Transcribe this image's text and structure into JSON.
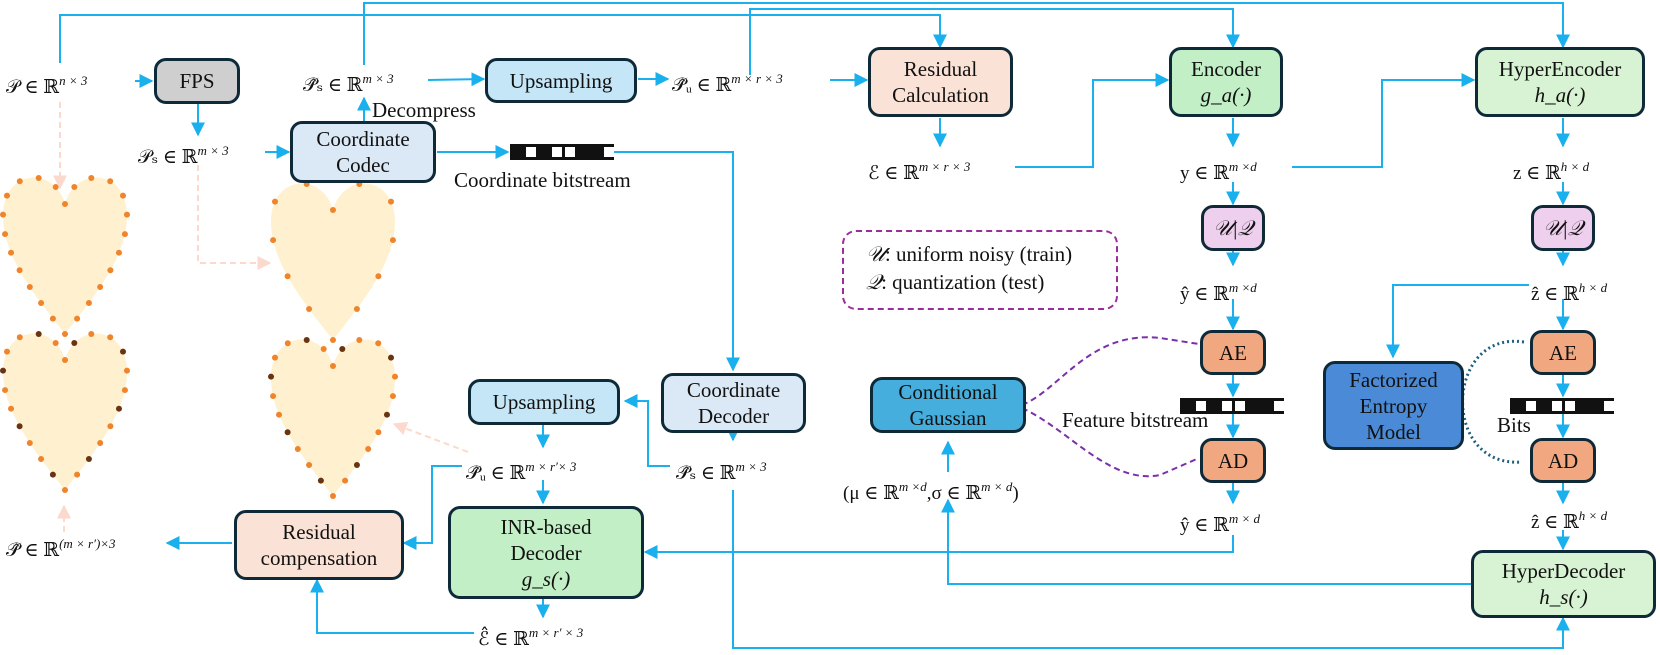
{
  "colors": {
    "arrow": "#1ab0ee",
    "node_border": "#0e2a38",
    "fps": "#cfcfcf",
    "light_blue": "#c5e6f7",
    "pale_blue": "#dbe8f6",
    "peach": "#fbe2d6",
    "green": "#c2efc6",
    "light_green": "#d8f3d3",
    "pink": "#efcfee",
    "orange": "#f1a881",
    "cond_gaussian": "#45aedd",
    "factorized": "#4a8ad6",
    "heart_fill": "#fff1cf",
    "point_orange": "#f0842a",
    "point_dark": "#6b3410",
    "legend_dash": "#9b2c9b",
    "entropy_link": "#1f5f80"
  },
  "nodes": {
    "fps": "FPS",
    "coordinate_codec": [
      "Coordinate",
      "Codec"
    ],
    "upsampling_top": "Upsampling",
    "residual_calculation": [
      "Residual",
      "Calculation"
    ],
    "encoder": [
      "Encoder",
      "g_a(·)"
    ],
    "hyper_encoder": [
      "HyperEncoder",
      "h_a(·)"
    ],
    "uq_main": "𝒰|𝒬",
    "uq_hyper": "𝒰|𝒬",
    "ae_main": "AE",
    "ad_main": "AD",
    "ae_hyper": "AE",
    "ad_hyper": "AD",
    "conditional_gaussian": [
      "Conditional",
      "Gaussian"
    ],
    "factorized_entropy_model": [
      "Factorized",
      "Entropy",
      "Model"
    ],
    "hyper_decoder": [
      "HyperDecoder",
      "h_s(·)"
    ],
    "coordinate_decoder": [
      "Coordinate",
      "Decoder"
    ],
    "upsampling_bottom": "Upsampling",
    "inr_decoder": [
      "INR-based",
      "Decoder",
      "g_s(·)"
    ],
    "residual_compensation": [
      "Residual",
      "compensation"
    ]
  },
  "labels": {
    "p_input": "𝒫 ∈ ℝ^{n × 3}",
    "p_s": "𝒫_s ∈ ℝ^{m × 3}",
    "p_s_hat_top": "𝒫̂_s ∈ ℝ^{m × 3}",
    "p_u_hat_top": "𝒫̂_u ∈ ℝ^{m × r × 3}",
    "e": "ℰ ∈ ℝ^{m × r × 3}",
    "y": "y ∈ ℝ^{m × d}",
    "y_hat_q": "ŷ ∈ ℝ^{m × d}",
    "y_hat_d": "ŷ ∈ ℝ^{m × d}",
    "z": "z ∈ ℝ^{h × d}",
    "z_hat_q": "ẑ ∈ ℝ^{h × d}",
    "z_hat_d": "ẑ ∈ ℝ^{h × d}",
    "mu_sigma": "(μ ∈ ℝ^{m × d}, σ ∈ ℝ^{m × d})",
    "p_s_hat_bottom": "𝒫̂_s ∈ ℝ^{m × 3}",
    "p_u_hat_bottom": "𝒫̂_u ∈ ℝ^{m × r′ × 3}",
    "e_hat": "ℰ̂ ∈ ℝ^{m × r′ × 3}",
    "p_hat_output": "𝒫̂ ∈ ℝ^{(m × r′) × 3}"
  },
  "label_parts": {
    "p_input": {
      "base": "𝒫 ∈ ℝ",
      "sup": "n × 3"
    },
    "p_s": {
      "base": "𝒫ₛ ∈ ℝ",
      "sup": "m × 3"
    },
    "p_s_hat_top": {
      "base": "𝒫̂ₛ ∈ ℝ",
      "sup": "m × 3"
    },
    "p_u_hat_top": {
      "base": "𝒫̂ᵤ ∈ ℝ",
      "sup": "m × r × 3"
    },
    "e": {
      "base": "ℰ ∈ ℝ",
      "sup": "m × r × 3"
    },
    "y": {
      "base": "y ∈ ℝ",
      "sup": "m ×d"
    },
    "y_hat_q": {
      "base": "ŷ ∈ ℝ",
      "sup": "m ×d"
    },
    "y_hat_d": {
      "base": "ŷ ∈ ℝ",
      "sup": "m × d"
    },
    "z": {
      "base": "z ∈ ℝ",
      "sup": "h × d"
    },
    "z_hat_q": {
      "base": "ẑ ∈ ℝ",
      "sup": "h × d"
    },
    "z_hat_d": {
      "base": "ẑ ∈ ℝ",
      "sup": "h × d"
    },
    "mu": {
      "base": "(μ ∈ ℝ",
      "sup": "m ×d"
    },
    "sigma": {
      "base": ",σ ∈ ℝ",
      "sup": "m × d",
      "tail": ")"
    },
    "p_s_hat_bottom": {
      "base": "𝒫̂ₛ ∈ ℝ",
      "sup": "m × 3"
    },
    "p_u_hat_bottom": {
      "base": "𝒫̂ᵤ ∈ ℝ",
      "sup": "m × r′× 3"
    },
    "e_hat": {
      "base": "ℰ̂ ∈ ℝ",
      "sup": "m × r′ × 3"
    },
    "p_hat_output": {
      "base": "𝒫̂ ∈ ℝ",
      "sup": "(m × r′)×3"
    }
  },
  "annotations": {
    "decompress": "Decompress",
    "coordinate_bitstream": "Coordinate bitstream",
    "feature_bitstream": "Feature bitstream",
    "bits": "Bits"
  },
  "legend": {
    "line1_symbol": "𝒰",
    "line1_text": ": uniform noisy (train)",
    "line2_symbol": "𝒬",
    "line2_text": ": quantization (test)"
  },
  "bitstream_pattern": [
    0,
    1,
    0,
    1,
    1,
    0,
    0,
    1
  ]
}
